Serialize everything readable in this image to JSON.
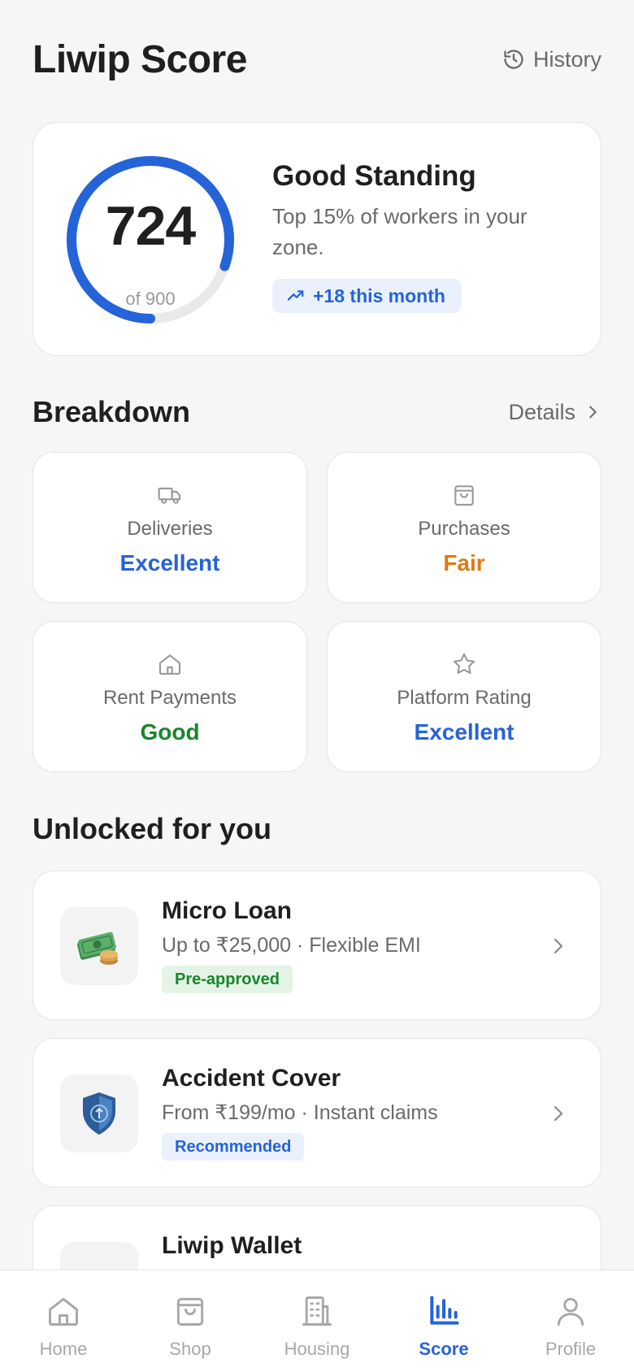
{
  "header": {
    "title": "Liwip Score",
    "history_label": "History",
    "history_icon": "history-icon"
  },
  "score": {
    "value": "724",
    "max_label": "of 900",
    "fraction": 0.804,
    "status_title": "Good Standing",
    "status_desc": "Top 15% of workers in your zone.",
    "trend_label": "+18 this month",
    "accent": "#2563d9"
  },
  "breakdown": {
    "title": "Breakdown",
    "details_label": "Details",
    "items": [
      {
        "label": "Deliveries",
        "value": "Excellent",
        "icon": "truck-icon",
        "color": "#2563d9"
      },
      {
        "label": "Purchases",
        "value": "Fair",
        "icon": "shopping-bag-icon",
        "color": "#e07a12"
      },
      {
        "label": "Rent Payments",
        "value": "Good",
        "icon": "home-icon",
        "color": "#17862a"
      },
      {
        "label": "Platform Rating",
        "value": "Excellent",
        "icon": "star-icon",
        "color": "#2563d9"
      }
    ]
  },
  "unlocked": {
    "title": "Unlocked for you",
    "items": [
      {
        "title": "Micro Loan",
        "subtitle": "Up to ₹25,000 · Flexible EMI",
        "tag": "Pre-approved",
        "icon": "money-stack-icon"
      },
      {
        "title": "Accident Cover",
        "subtitle": "From ₹199/mo · Instant claims",
        "tag": "Recommended",
        "icon": "shield-icon"
      },
      {
        "title": "Liwip Wallet",
        "icon": "wallet-icon"
      }
    ]
  },
  "nav": {
    "items": [
      {
        "label": "Home",
        "icon": "home-icon"
      },
      {
        "label": "Shop",
        "icon": "shopping-bag-icon"
      },
      {
        "label": "Housing",
        "icon": "building-icon"
      },
      {
        "label": "Score",
        "icon": "bar-chart-icon",
        "active": true
      },
      {
        "label": "Profile",
        "icon": "user-icon"
      }
    ]
  }
}
